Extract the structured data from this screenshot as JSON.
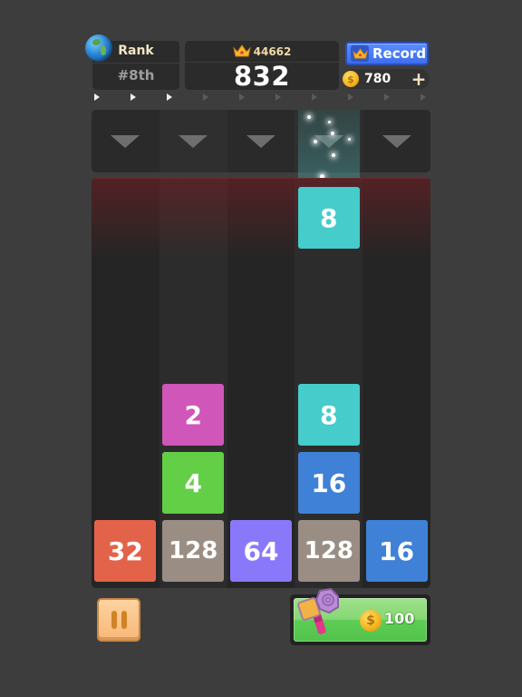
{
  "header": {
    "rank_label": "Rank",
    "rank_value": "#8th",
    "best_score": "44662",
    "current_score": "832",
    "record_label": "Record",
    "coins": "780",
    "add_coins_symbol": "+"
  },
  "progress": {
    "total_steps": 10,
    "completed_steps": 3
  },
  "drop_columns": [
    {
      "label": "column-1"
    },
    {
      "label": "column-2"
    },
    {
      "label": "column-3"
    },
    {
      "label": "column-4",
      "highlighted": true
    },
    {
      "label": "column-5"
    }
  ],
  "falling_tile": {
    "value": "8",
    "column": 4,
    "color": "#45cccb"
  },
  "tiles": [
    {
      "value": "32",
      "column": 1,
      "row": 1,
      "color": "#e3634a"
    },
    {
      "value": "128",
      "column": 2,
      "row": 1,
      "color": "#9a8e84"
    },
    {
      "value": "4",
      "column": 2,
      "row": 2,
      "color": "#63cf46"
    },
    {
      "value": "2",
      "column": 2,
      "row": 3,
      "color": "#d156b9"
    },
    {
      "value": "64",
      "column": 3,
      "row": 1,
      "color": "#8a78fb"
    },
    {
      "value": "128",
      "column": 4,
      "row": 1,
      "color": "#9a8e84"
    },
    {
      "value": "16",
      "column": 4,
      "row": 2,
      "color": "#3e81d6"
    },
    {
      "value": "8",
      "column": 4,
      "row": 3,
      "color": "#45cccb"
    },
    {
      "value": "16",
      "column": 5,
      "row": 1,
      "color": "#3e81d6"
    }
  ],
  "controls": {
    "hammer_price": "100",
    "coin_symbol": "$"
  }
}
